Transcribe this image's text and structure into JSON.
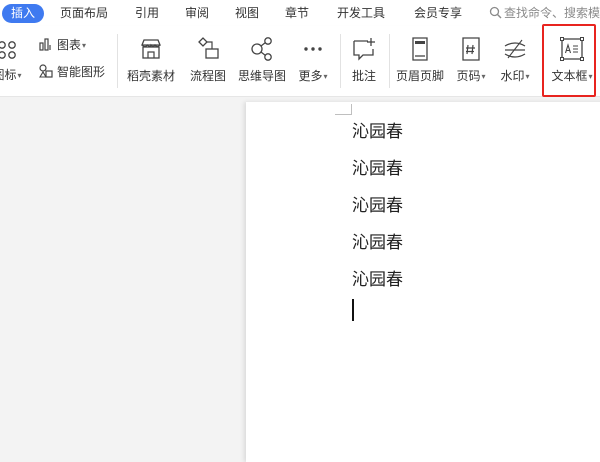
{
  "tabs": {
    "active": "插入",
    "items": [
      "页面布局",
      "引用",
      "审阅",
      "视图",
      "章节",
      "开发工具",
      "会员专享"
    ]
  },
  "search": {
    "text": "查找命令、搜索模"
  },
  "ribbon": {
    "icon_partial_label": "图标",
    "chart_label": "图表",
    "smartart_label": "智能图形",
    "daoke_label": "稻壳素材",
    "flowchart_label": "流程图",
    "mindmap_label": "思维导图",
    "more_label": "更多",
    "comment_label": "批注",
    "header_footer_label": "页眉页脚",
    "page_number_label": "页码",
    "watermark_label": "水印",
    "textbox_label": "文本框"
  },
  "document": {
    "lines": [
      "沁园春",
      "沁园春",
      "沁园春",
      "沁园春",
      "沁园春"
    ]
  },
  "colors": {
    "accent": "#3f7af0",
    "highlight_box": "#e8241f"
  }
}
